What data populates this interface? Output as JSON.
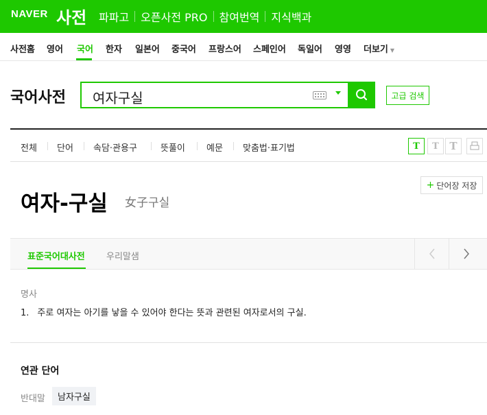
{
  "header": {
    "logo": "NAVER",
    "service": "사전",
    "nav": [
      "파파고",
      "오픈사전 PRO",
      "참여번역",
      "지식백과"
    ]
  },
  "subnav": {
    "items": [
      "사전홈",
      "영어",
      "국어",
      "한자",
      "일본어",
      "중국어",
      "프랑스어",
      "스페인어",
      "독일어",
      "영영",
      "더보기"
    ],
    "active": "국어"
  },
  "search": {
    "dict_title": "국어사전",
    "query": "여자구실",
    "advanced_label": "고급 검색"
  },
  "filters": [
    "전체",
    "단어",
    "속담·관용구",
    "뜻풀이",
    "예문",
    "맞춤법·표기법"
  ],
  "font_size_buttons": [
    "T",
    "T",
    "T"
  ],
  "entry": {
    "word": "여자-구실",
    "hanja": "女子구실",
    "save_label": "단어장 저장",
    "source_tabs": [
      "표준국어대사전",
      "우리말샘"
    ],
    "part_of_speech": "명사",
    "definition_number": "1.",
    "definition": "주로 여자는 아기를 낳을 수 있어야 한다는 뜻과 관련된 여자로서의 구실."
  },
  "related": {
    "title": "연관 단어",
    "label": "반대말",
    "word": "남자구실"
  },
  "colors": {
    "brand": "#1ec800"
  }
}
